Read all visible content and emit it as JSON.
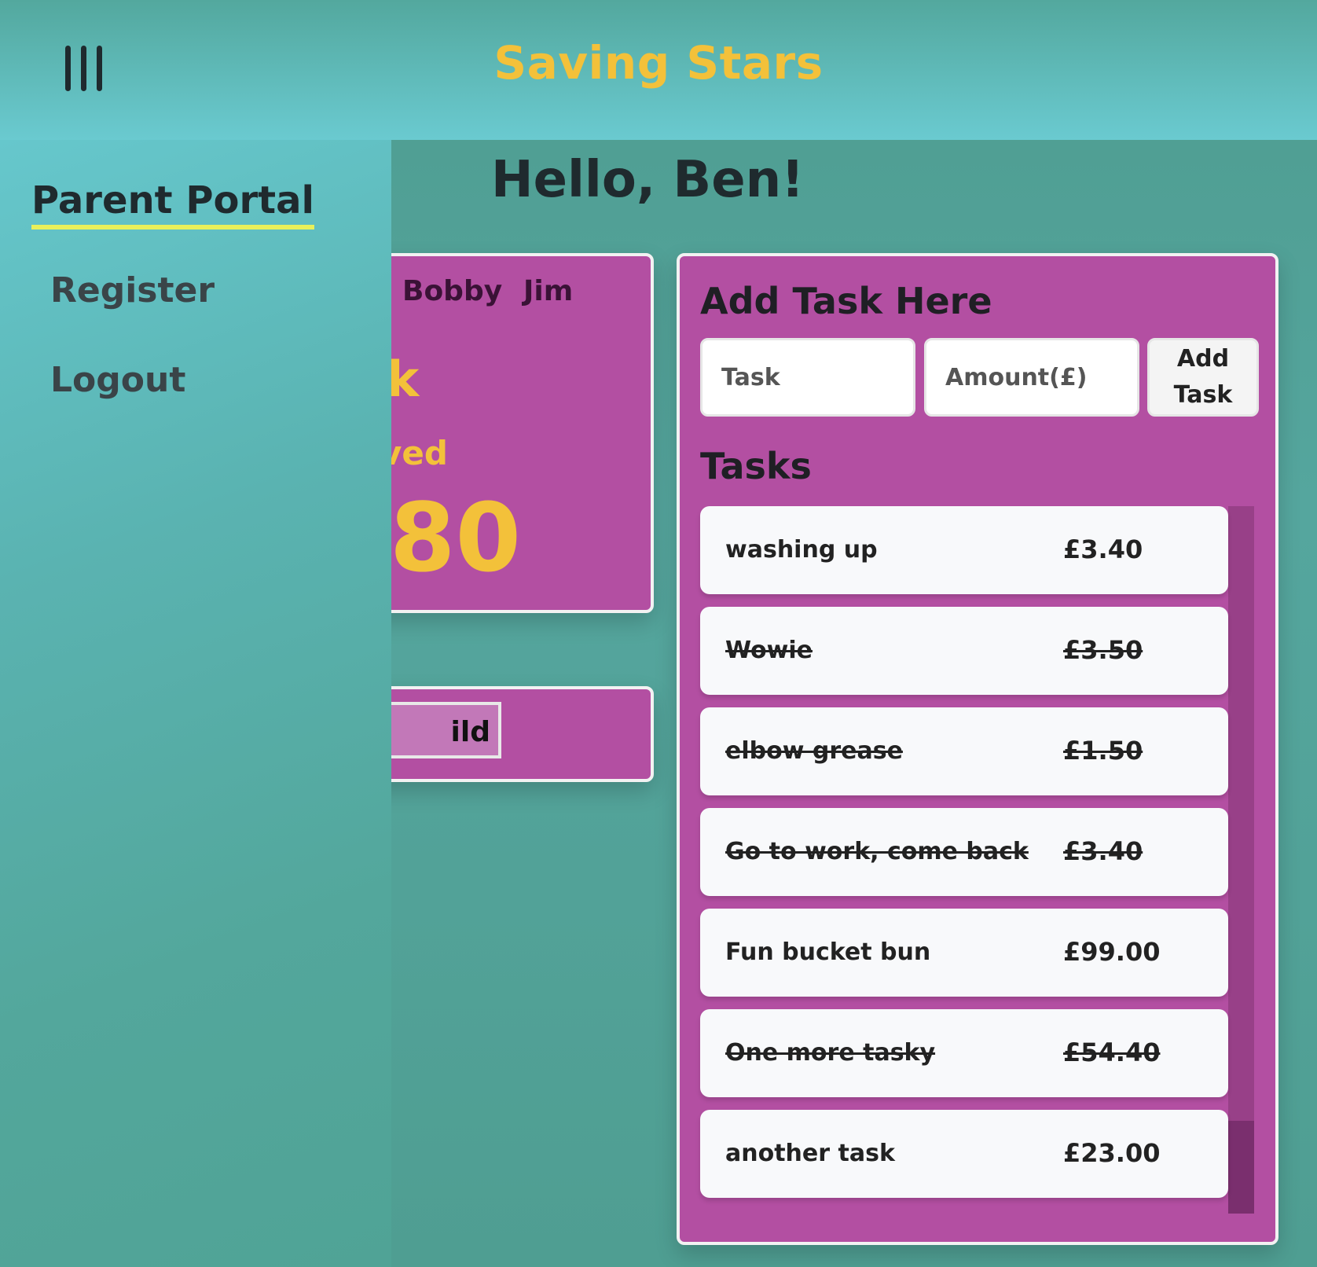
{
  "app": {
    "title": "Saving Stars"
  },
  "drawer": {
    "title": "Parent Portal",
    "links": [
      {
        "label": "Register"
      },
      {
        "label": "Logout"
      }
    ]
  },
  "main": {
    "greeting": "Hello, Ben!",
    "child_card": {
      "tabs": [
        "Bobby",
        "Jim"
      ],
      "selected_child_partial": "k",
      "saved_label_partial": "ved",
      "saved_value_partial": "80"
    },
    "add_child_button_partial": "ild",
    "task_panel": {
      "add_title": "Add Task Here",
      "task_placeholder": "Task",
      "amount_placeholder": "Amount(£)",
      "add_button": "Add Task",
      "list_title": "Tasks",
      "tasks": [
        {
          "name": "washing up",
          "amount": "£3.40",
          "done": false
        },
        {
          "name": "Wowie",
          "amount": "£3.50",
          "done": true
        },
        {
          "name": "elbow grease",
          "amount": "£1.50",
          "done": true
        },
        {
          "name": "Go to work, come back",
          "amount": "£3.40",
          "done": true
        },
        {
          "name": "Fun bucket bun",
          "amount": "£99.00",
          "done": false
        },
        {
          "name": "One more tasky",
          "amount": "£54.40",
          "done": true
        },
        {
          "name": "another task",
          "amount": "£23.00",
          "done": false
        }
      ]
    }
  },
  "colors": {
    "accent_yellow": "#f3c13a",
    "card_purple": "#b34fa2",
    "teal": "#5ab3b1"
  }
}
